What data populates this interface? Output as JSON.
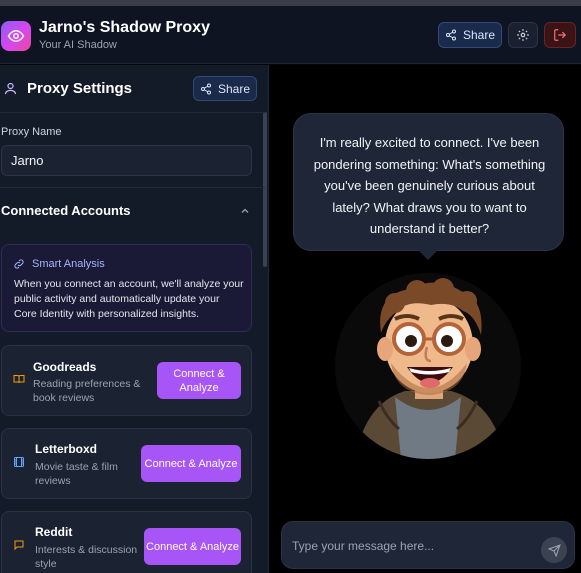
{
  "header": {
    "title": "Jarno's Shadow Proxy",
    "subtitle": "Your AI Shadow",
    "share_label": "Share",
    "logo_icon": "eye-icon",
    "settings_icon": "gear-icon",
    "exit_icon": "logout-icon"
  },
  "sidebar": {
    "title": "Proxy Settings",
    "share_label": "Share",
    "proxy_name_label": "Proxy Name",
    "proxy_name_value": "Jarno",
    "connected_title": "Connected Accounts",
    "smart_analysis": {
      "title": "Smart Analysis",
      "text": "When you connect an account, we'll analyze your public activity and automatically update your Core Identity with personalized insights."
    },
    "accounts": [
      {
        "name": "Goodreads",
        "desc": "Reading preferences & book reviews",
        "button": "Connect & Analyze",
        "icon": "book-icon"
      },
      {
        "name": "Letterboxd",
        "desc": "Movie taste & film reviews",
        "button": "Connect & Analyze",
        "icon": "film-icon"
      },
      {
        "name": "Reddit",
        "desc": "Interests & discussion style",
        "button": "Connect & Analyze",
        "icon": "chat-icon"
      }
    ]
  },
  "chat": {
    "message": "I'm really excited to connect. I've been pondering something: What's something you've been genuinely curious about lately? What draws you to want to understand it better?",
    "input_placeholder": "Type your message here..."
  },
  "colors": {
    "accent": "#a855f7",
    "share_bg": "#1a2a4a",
    "exit_bg": "#3a1316",
    "panel_bg": "#131a28"
  }
}
